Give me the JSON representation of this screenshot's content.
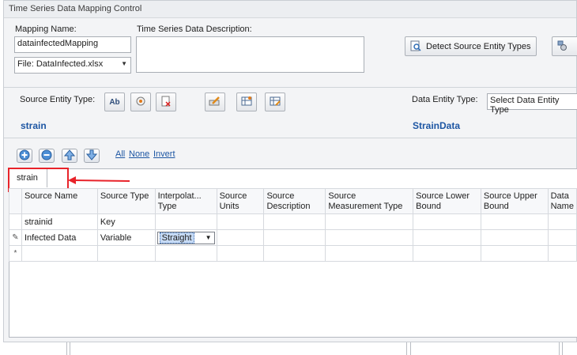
{
  "window": {
    "title": "Time Series Data Mapping Control"
  },
  "form": {
    "mapping_name_label": "Mapping Name:",
    "mapping_name_value": "datainfectedMapping",
    "description_label": "Time Series Data Description:",
    "file_value": "File: DataInfected.xlsx",
    "detect_button": "Detect Source Entity Types"
  },
  "entity": {
    "source_label": "Source Entity Type:",
    "source_value": "strain",
    "data_label": "Data Entity Type:",
    "data_combo_value": "Select Data Entity Type",
    "data_value": "StrainData"
  },
  "grid_toolbar": {
    "all": "All",
    "none": "None",
    "invert": "Invert"
  },
  "tabs": [
    {
      "label": "strain"
    }
  ],
  "grid": {
    "headers": [
      "Source Name",
      "Source Type",
      "Interpolat... Type",
      "Source Units",
      "Source Description",
      "Source Measurement Type",
      "Source Lower Bound",
      "Source Upper Bound",
      "Data Name"
    ],
    "rows": [
      {
        "indicator": "",
        "name": "strainid",
        "type": "Key",
        "interp": "",
        "units": "",
        "description": "",
        "measurement": "",
        "lower": "",
        "upper": "",
        "data": ""
      },
      {
        "indicator": "✎",
        "name": "Infected Data",
        "type": "Variable",
        "interp": "Straight",
        "units": "",
        "description": "",
        "measurement": "",
        "lower": "",
        "upper": "",
        "data": ""
      }
    ],
    "new_row_indicator": "*"
  },
  "colors": {
    "accent": "#1d56a3",
    "highlight": "#e8232a"
  }
}
